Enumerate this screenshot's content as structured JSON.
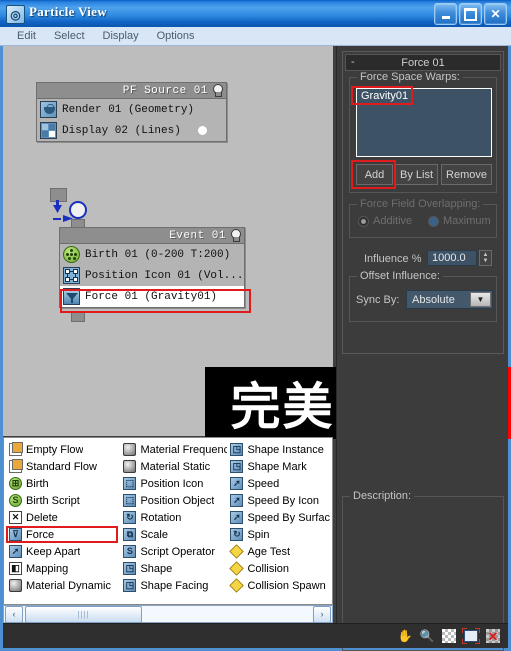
{
  "window": {
    "title": "Particle View",
    "icon": "particle-view-icon",
    "buttons": {
      "minimize": "minimize-icon",
      "maximize": "maximize-icon",
      "close": "close-icon"
    }
  },
  "menubar": {
    "items": [
      "Edit",
      "Select",
      "Display",
      "Options"
    ]
  },
  "canvas": {
    "nodes": [
      {
        "title": "PF Source 01",
        "rows": [
          {
            "icon": "teapot-icon",
            "label": "Render 01  (Geometry)"
          },
          {
            "icon": "grid-icon",
            "label": "Display 02  (Lines)"
          }
        ]
      },
      {
        "title": "Event 01",
        "rows": [
          {
            "icon": "birth-icon",
            "label": "Birth 01  (0-200 T:200)"
          },
          {
            "icon": "position-icon",
            "label": "Position Icon 01  (Vol..."
          },
          {
            "icon": "force-icon",
            "label": "Force 01  (Gravity01)",
            "selected": true
          }
        ]
      }
    ]
  },
  "watermark": {
    "black_text": "完美",
    "red_text": "动力"
  },
  "depot": {
    "columns": [
      [
        {
          "label": "Empty Flow",
          "icon": "flow-icon"
        },
        {
          "label": "Standard Flow",
          "icon": "flow-icon"
        },
        {
          "label": "Birth",
          "icon": "birth-green-icon",
          "glyph": "⊞"
        },
        {
          "label": "Birth Script",
          "icon": "birth-script-icon",
          "glyph": "S"
        },
        {
          "label": "Delete",
          "icon": "delete-icon",
          "glyph": "✕"
        },
        {
          "label": "Force",
          "icon": "force-icon",
          "glyph": "⊽",
          "highlighted": true
        },
        {
          "label": "Keep Apart",
          "icon": "keep-apart-icon",
          "glyph": "➚"
        },
        {
          "label": "Mapping",
          "icon": "mapping-icon",
          "glyph": "◧"
        },
        {
          "label": "Material Dynamic",
          "icon": "material-sphere-icon"
        }
      ],
      [
        {
          "label": "Material Frequency",
          "icon": "material-sphere-icon"
        },
        {
          "label": "Material Static",
          "icon": "material-sphere-icon"
        },
        {
          "label": "Position Icon",
          "icon": "position-icon",
          "glyph": "⬚"
        },
        {
          "label": "Position Object",
          "icon": "position-object-icon",
          "glyph": "⬚"
        },
        {
          "label": "Rotation",
          "icon": "rotation-icon",
          "glyph": "↻"
        },
        {
          "label": "Scale",
          "icon": "scale-icon",
          "glyph": "⧉"
        },
        {
          "label": "Script Operator",
          "icon": "script-icon",
          "glyph": "S"
        },
        {
          "label": "Shape",
          "icon": "shape-icon",
          "glyph": "◳"
        },
        {
          "label": "Shape Facing",
          "icon": "shape-facing-icon",
          "glyph": "◳"
        }
      ],
      [
        {
          "label": "Shape Instance",
          "icon": "shape-instance-icon",
          "glyph": "◳"
        },
        {
          "label": "Shape Mark",
          "icon": "shape-mark-icon",
          "glyph": "◳"
        },
        {
          "label": "Speed",
          "icon": "speed-icon",
          "glyph": "➚"
        },
        {
          "label": "Speed By Icon",
          "icon": "speed-by-icon",
          "glyph": "➚"
        },
        {
          "label": "Speed By Surfac",
          "icon": "speed-by-surface-icon",
          "glyph": "➚"
        },
        {
          "label": "Spin",
          "icon": "spin-icon",
          "glyph": "↻"
        },
        {
          "label": "Age Test",
          "icon": "test-diamond-icon",
          "glyph": "◆"
        },
        {
          "label": "Collision",
          "icon": "test-diamond-icon",
          "glyph": "◆"
        },
        {
          "label": "Collision Spawn",
          "icon": "test-diamond-icon",
          "glyph": "◆"
        }
      ]
    ]
  },
  "scrollbar": {
    "left_arrow": "‹",
    "right_arrow": "›",
    "grip": "||||"
  },
  "panel": {
    "rollup": {
      "title": "Force 01",
      "minimize": "-",
      "space_warps_caption": "Force Space Warps:",
      "list_items": [
        "Gravity01"
      ],
      "buttons": {
        "add": "Add",
        "by_list": "By List",
        "remove": "Remove"
      },
      "overlap_caption": "Force Field Overlapping:",
      "overlap_options": [
        {
          "label": "Additive",
          "selected": true
        },
        {
          "label": "Maximum",
          "selected": false
        }
      ],
      "influence_label": "Influence %",
      "influence_value": "1000.0",
      "offset_caption": "Offset Influence:",
      "sync_label": "Sync By:",
      "sync_value": "Absolute"
    },
    "description_caption": "Description:"
  },
  "statusbar": {
    "tools": [
      {
        "name": "pan-icon",
        "glyph": "✋"
      },
      {
        "name": "zoom-icon",
        "glyph": "🔍"
      },
      {
        "name": "zoom-region-icon",
        "glyph": ""
      },
      {
        "name": "zoom-extents-icon",
        "glyph": ""
      },
      {
        "name": "no-zoom-icon",
        "glyph": ""
      }
    ]
  },
  "colors": {
    "title_blue": "#2d8ae0",
    "highlight_red": "#e01b1b",
    "panel_bg": "#3c3c3c",
    "canvas_bg": "#bdbdbd",
    "accent_blue": "#4e8fd2"
  }
}
